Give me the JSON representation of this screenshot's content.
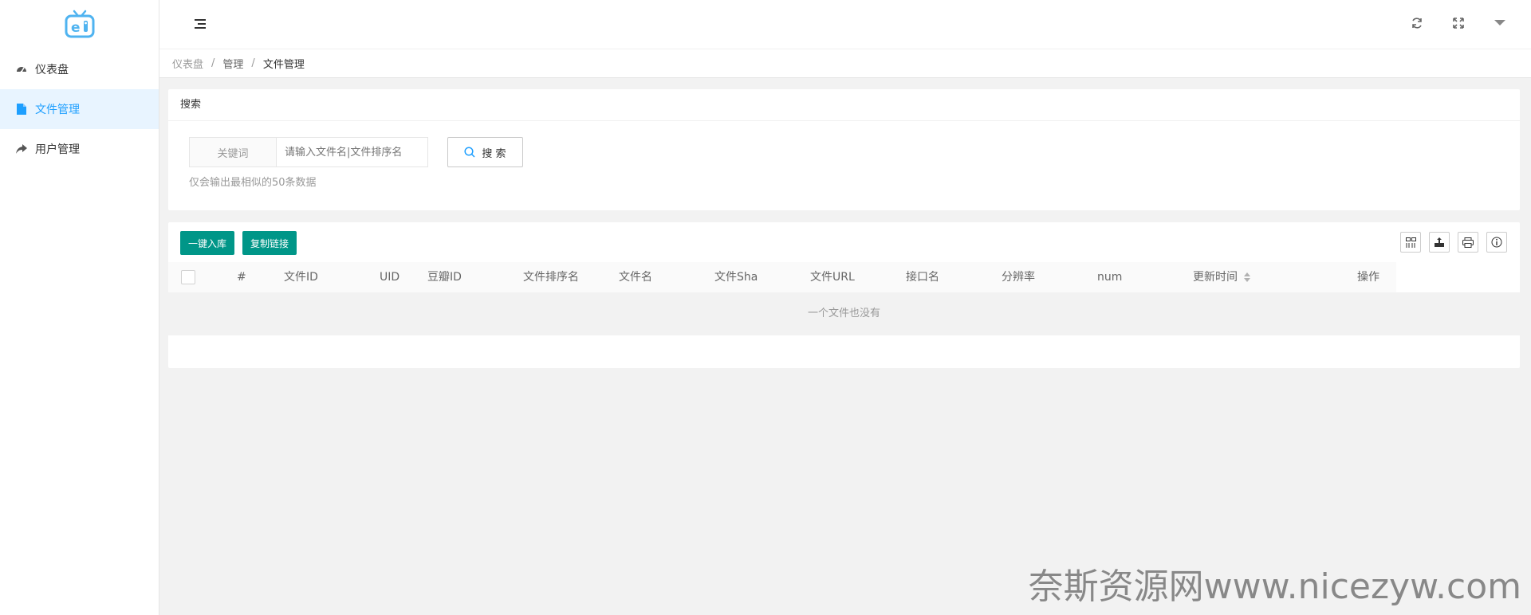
{
  "sidebar": {
    "logo_name": "tv-logo",
    "items": [
      {
        "label": "仪表盘",
        "icon": "dashboard-icon",
        "active": false
      },
      {
        "label": "文件管理",
        "icon": "file-icon",
        "active": true
      },
      {
        "label": "用户管理",
        "icon": "share-arrow-icon",
        "active": false
      }
    ]
  },
  "header": {
    "icons": [
      "menu-toggle-icon",
      "refresh-icon",
      "fullscreen-icon",
      "caret-down-icon"
    ]
  },
  "breadcrumb": {
    "items": [
      "仪表盘",
      "管理",
      "文件管理"
    ],
    "separator": "/"
  },
  "search": {
    "title": "搜索",
    "field_label": "关键词",
    "placeholder": "请输入文件名|文件排序名",
    "button_label": "搜 索",
    "hint": "仅会输出最相似的50条数据"
  },
  "table": {
    "buttons": [
      "一键入库",
      "复制链接"
    ],
    "tool_icons": [
      "columns-icon",
      "export-icon",
      "print-icon",
      "info-icon"
    ],
    "columns": [
      "#",
      "文件ID",
      "UID",
      "豆瓣ID",
      "文件排序名",
      "文件名",
      "文件Sha",
      "文件URL",
      "接口名",
      "分辨率",
      "num",
      "更新时间",
      "操作"
    ],
    "empty_text": "一个文件也没有"
  },
  "watermark": "奈斯资源网www.nicezyw.com",
  "colors": {
    "accent": "#1e9fff",
    "primary_button": "#009688",
    "active_menu_bg": "#e8f4ff"
  }
}
